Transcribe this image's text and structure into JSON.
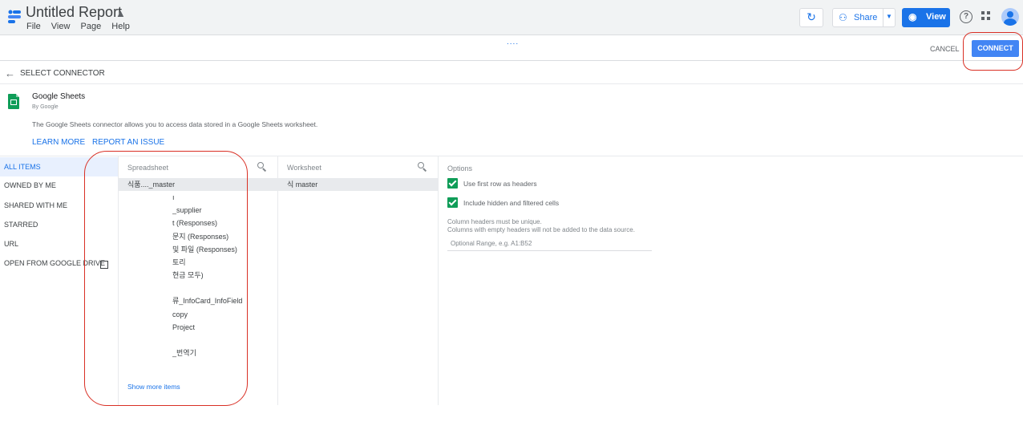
{
  "app": {
    "title": "Untitled Report",
    "menu": [
      "File",
      "View",
      "Page",
      "Help"
    ],
    "share_label": "Share",
    "view_label": "View",
    "help_glyph": "?"
  },
  "toolbar": {
    "drag_handle": "....",
    "cancel_label": "CANCEL",
    "connect_label": "CONNECT"
  },
  "header": {
    "back_glyph": "←",
    "select_connector": "SELECT CONNECTOR"
  },
  "connector": {
    "name": "Google Sheets",
    "by": "By Google",
    "description": "The Google Sheets connector allows you to access data stored in a Google Sheets worksheet.",
    "learn_more": "LEARN MORE",
    "report_issue": "REPORT AN ISSUE",
    "icon": "google-sheets-icon",
    "color": "#0f9d58"
  },
  "sidebar": {
    "items": [
      {
        "label": "ALL ITEMS",
        "active": true
      },
      {
        "label": "OWNED BY ME"
      },
      {
        "label": "SHARED WITH ME"
      },
      {
        "label": "STARRED"
      },
      {
        "label": "URL"
      },
      {
        "label": "OPEN FROM GOOGLE DRIVE",
        "icon": "open-external-icon"
      }
    ]
  },
  "spreadsheet": {
    "header": "Spreadsheet",
    "items": [
      "식품...._master",
      "ı",
      "_supplier",
      "t (Responses)",
      "문지 (Responses)",
      "및 파일 (Responses)",
      "토리",
      "현금 모두)",
      "",
      "류_InfoCard_InfoField",
      "copy",
      "Project",
      "",
      "_번역기"
    ],
    "show_more": "Show more items"
  },
  "worksheet": {
    "header": "Worksheet",
    "items": [
      "식 master"
    ]
  },
  "options": {
    "title": "Options",
    "use_first_row": "Use first row as headers",
    "include_hidden": "Include hidden and filtered cells",
    "note1": "Column headers must be unique.",
    "note2": "Columns with empty headers will not be added to the data source.",
    "range_placeholder": "Optional Range, e.g. A1:B52"
  },
  "colors": {
    "accent": "#1a73e8",
    "connect": "#4285f4",
    "annotation": "#d93025",
    "check": "#0f9d58"
  }
}
